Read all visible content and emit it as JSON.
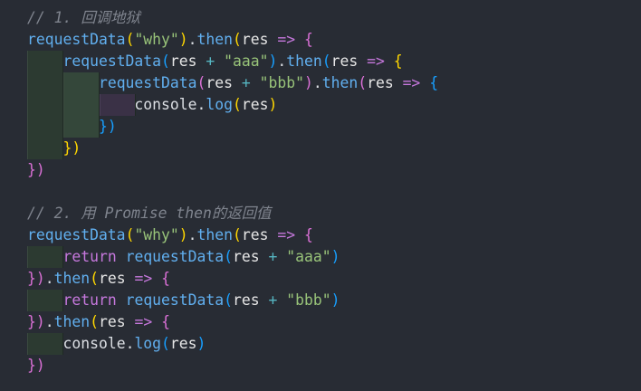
{
  "editor": {
    "background": "#282c34",
    "code_lines": [
      [
        {
          "t": "// 1. 回调地狱",
          "c": "comment"
        }
      ],
      [
        {
          "t": "requestData",
          "c": "func"
        },
        {
          "t": "(",
          "c": "p1"
        },
        {
          "t": "\"why\"",
          "c": "str"
        },
        {
          "t": ")",
          "c": "p1"
        },
        {
          "t": ".",
          "c": "plain"
        },
        {
          "t": "then",
          "c": "method"
        },
        {
          "t": "(",
          "c": "p1"
        },
        {
          "t": "res",
          "c": "param"
        },
        {
          "t": " ",
          "c": "plain"
        },
        {
          "t": "=>",
          "c": "kw"
        },
        {
          "t": " ",
          "c": "plain"
        },
        {
          "t": "{",
          "c": "p2"
        }
      ],
      [
        {
          "t": "    ",
          "c": "plain"
        },
        {
          "t": "requestData",
          "c": "func"
        },
        {
          "t": "(",
          "c": "p3"
        },
        {
          "t": "res",
          "c": "param"
        },
        {
          "t": " ",
          "c": "plain"
        },
        {
          "t": "+",
          "c": "op"
        },
        {
          "t": " ",
          "c": "plain"
        },
        {
          "t": "\"aaa\"",
          "c": "str"
        },
        {
          "t": ")",
          "c": "p3"
        },
        {
          "t": ".",
          "c": "plain"
        },
        {
          "t": "then",
          "c": "method"
        },
        {
          "t": "(",
          "c": "p3"
        },
        {
          "t": "res",
          "c": "param"
        },
        {
          "t": " ",
          "c": "plain"
        },
        {
          "t": "=>",
          "c": "kw"
        },
        {
          "t": " ",
          "c": "plain"
        },
        {
          "t": "{",
          "c": "p1"
        }
      ],
      [
        {
          "t": "        ",
          "c": "plain"
        },
        {
          "t": "requestData",
          "c": "func"
        },
        {
          "t": "(",
          "c": "p2"
        },
        {
          "t": "res",
          "c": "param"
        },
        {
          "t": " ",
          "c": "plain"
        },
        {
          "t": "+",
          "c": "op"
        },
        {
          "t": " ",
          "c": "plain"
        },
        {
          "t": "\"bbb\"",
          "c": "str"
        },
        {
          "t": ")",
          "c": "p2"
        },
        {
          "t": ".",
          "c": "plain"
        },
        {
          "t": "then",
          "c": "method"
        },
        {
          "t": "(",
          "c": "p2"
        },
        {
          "t": "res",
          "c": "param"
        },
        {
          "t": " ",
          "c": "plain"
        },
        {
          "t": "=>",
          "c": "kw"
        },
        {
          "t": " ",
          "c": "plain"
        },
        {
          "t": "{",
          "c": "p3"
        }
      ],
      [
        {
          "t": "            ",
          "c": "plain"
        },
        {
          "t": "console",
          "c": "plain"
        },
        {
          "t": ".",
          "c": "plain"
        },
        {
          "t": "log",
          "c": "method"
        },
        {
          "t": "(",
          "c": "p1"
        },
        {
          "t": "res",
          "c": "param"
        },
        {
          "t": ")",
          "c": "p1"
        }
      ],
      [
        {
          "t": "        ",
          "c": "plain"
        },
        {
          "t": "})",
          "c": "p3"
        }
      ],
      [
        {
          "t": "    ",
          "c": "plain"
        },
        {
          "t": "})",
          "c": "p1"
        }
      ],
      [
        {
          "t": "})",
          "c": "p2"
        }
      ],
      [],
      [
        {
          "t": "// 2. 用 Promise then的返回值",
          "c": "comment"
        }
      ],
      [
        {
          "t": "requestData",
          "c": "func"
        },
        {
          "t": "(",
          "c": "p1"
        },
        {
          "t": "\"why\"",
          "c": "str"
        },
        {
          "t": ")",
          "c": "p1"
        },
        {
          "t": ".",
          "c": "plain"
        },
        {
          "t": "then",
          "c": "method"
        },
        {
          "t": "(",
          "c": "p1"
        },
        {
          "t": "res",
          "c": "param"
        },
        {
          "t": " ",
          "c": "plain"
        },
        {
          "t": "=>",
          "c": "kw"
        },
        {
          "t": " ",
          "c": "plain"
        },
        {
          "t": "{",
          "c": "p2"
        }
      ],
      [
        {
          "t": "    ",
          "c": "plain"
        },
        {
          "t": "return",
          "c": "kw"
        },
        {
          "t": " ",
          "c": "plain"
        },
        {
          "t": "requestData",
          "c": "func"
        },
        {
          "t": "(",
          "c": "p3"
        },
        {
          "t": "res",
          "c": "param"
        },
        {
          "t": " ",
          "c": "plain"
        },
        {
          "t": "+",
          "c": "op"
        },
        {
          "t": " ",
          "c": "plain"
        },
        {
          "t": "\"aaa\"",
          "c": "str"
        },
        {
          "t": ")",
          "c": "p3"
        }
      ],
      [
        {
          "t": "})",
          "c": "p2"
        },
        {
          "t": ".",
          "c": "plain"
        },
        {
          "t": "then",
          "c": "method"
        },
        {
          "t": "(",
          "c": "p1"
        },
        {
          "t": "res",
          "c": "param"
        },
        {
          "t": " ",
          "c": "plain"
        },
        {
          "t": "=>",
          "c": "kw"
        },
        {
          "t": " ",
          "c": "plain"
        },
        {
          "t": "{",
          "c": "p2"
        }
      ],
      [
        {
          "t": "    ",
          "c": "plain"
        },
        {
          "t": "return",
          "c": "kw"
        },
        {
          "t": " ",
          "c": "plain"
        },
        {
          "t": "requestData",
          "c": "func"
        },
        {
          "t": "(",
          "c": "p3"
        },
        {
          "t": "res",
          "c": "param"
        },
        {
          "t": " ",
          "c": "plain"
        },
        {
          "t": "+",
          "c": "op"
        },
        {
          "t": " ",
          "c": "plain"
        },
        {
          "t": "\"bbb\"",
          "c": "str"
        },
        {
          "t": ")",
          "c": "p3"
        }
      ],
      [
        {
          "t": "})",
          "c": "p2"
        },
        {
          "t": ".",
          "c": "plain"
        },
        {
          "t": "then",
          "c": "method"
        },
        {
          "t": "(",
          "c": "p1"
        },
        {
          "t": "res",
          "c": "param"
        },
        {
          "t": " ",
          "c": "plain"
        },
        {
          "t": "=>",
          "c": "kw"
        },
        {
          "t": " ",
          "c": "plain"
        },
        {
          "t": "{",
          "c": "p2"
        }
      ],
      [
        {
          "t": "    ",
          "c": "plain"
        },
        {
          "t": "console",
          "c": "plain"
        },
        {
          "t": ".",
          "c": "plain"
        },
        {
          "t": "log",
          "c": "method"
        },
        {
          "t": "(",
          "c": "p3"
        },
        {
          "t": "res",
          "c": "param"
        },
        {
          "t": ")",
          "c": "p3"
        }
      ],
      [
        {
          "t": "})",
          "c": "p2"
        }
      ]
    ]
  }
}
